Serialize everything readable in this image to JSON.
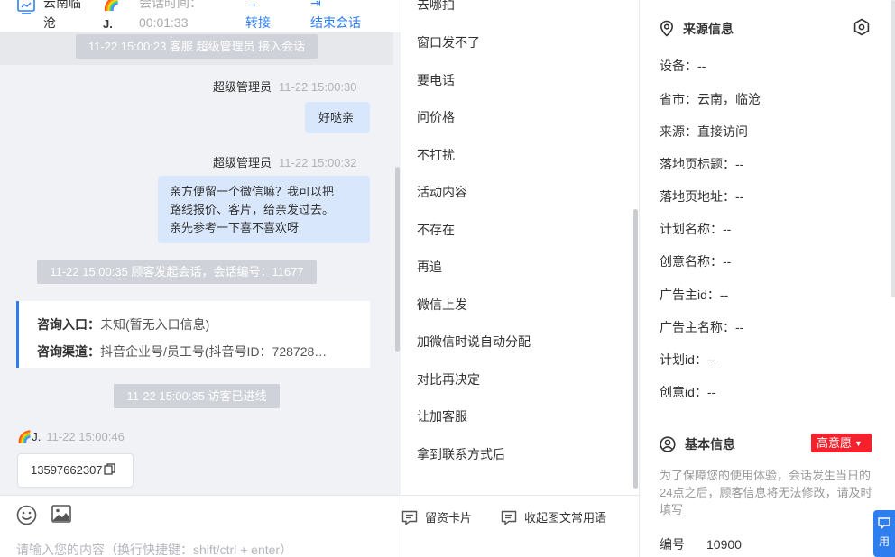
{
  "header": {
    "location": "云南临沧",
    "visitor_name": "J.",
    "duration_label": "会话时间：",
    "duration": "00:01:33",
    "transfer_label": "转接",
    "end_label": "结束会话"
  },
  "messages": {
    "sys_connect": "11-22 15:00:23 客服 超级管理员 接入会话",
    "agent_name": "超级管理员",
    "msg1_time": "11-22 15:00:30",
    "msg1_text": "好哒亲",
    "msg2_time": "11-22 15:00:32",
    "msg2_line1": "亲方便留一个微信嘛？我可以把",
    "msg2_line2": "路线报价、客片，给亲发过去。",
    "msg2_line3": "亲先参考一下喜不喜欢呀",
    "sys_session": "11-22 15:00:35 顾客发起会话，会话编号：11677",
    "entry_label": "咨询入口：",
    "entry_value": "未知(暂无入口信息)",
    "channel_label": "咨询渠道：",
    "channel_value": "抖音企业号/员工号(抖音号ID：728728…",
    "sys_enter": "11-22 15:00:35 访客已进线",
    "visitor_name": "J.",
    "visitor_time": "11-22 15:00:46",
    "visitor_phone": "13597662307"
  },
  "input": {
    "placeholder": "请输入您的内容（换行快捷键：shift/ctrl + enter）"
  },
  "quick_replies": [
    "去哪拍",
    "窗口发不了",
    "要电话",
    "问价格",
    "不打扰",
    "活动内容",
    "不存在",
    "再追",
    "微信上发",
    "加微信时说自动分配",
    "对比再决定",
    "让加客服",
    "拿到联系方式后"
  ],
  "quick_footer": {
    "card_label": "留资卡片",
    "collapse_label": "收起图文常用语"
  },
  "source_info": {
    "title": "来源信息",
    "rows": [
      "设备：--",
      "省市：云南，临沧",
      "来源：直接访问",
      "落地页标题：--",
      "落地页地址：--",
      "计划名称：--",
      "创意名称：--",
      "广告主id：--",
      "广告主名称：--",
      "计划id：--",
      "创意id：--"
    ]
  },
  "basic_info": {
    "title": "基本信息",
    "intent_label": "高意愿",
    "notice": "为了保障您的使用体验，会话发生当日的24点之后，顾客信息将无法修改，请及时填写",
    "code_label": "编号",
    "code_value": "10900"
  },
  "float_button_label": "用",
  "colors": {
    "accent": "#2e7ef0",
    "bubble": "#d9e7fc",
    "intent": "#f5222d"
  }
}
